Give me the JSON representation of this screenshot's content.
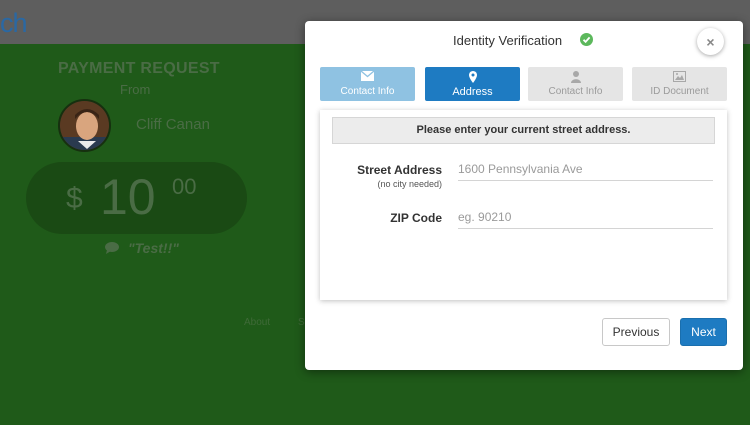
{
  "app": {
    "logo_text": "ch"
  },
  "payment": {
    "title": "PAYMENT REQUEST",
    "from_label": "From",
    "payer_name": "Cliff Canan",
    "currency_symbol": "$",
    "amount_whole": "10",
    "amount_cents": "00",
    "note": "\"Test!!\""
  },
  "footer": {
    "links": [
      "About",
      "S"
    ]
  },
  "modal": {
    "title": "Identity Verification",
    "title_icon": "check-circle-icon",
    "close_label": "×",
    "steps": [
      {
        "label": "Contact Info",
        "icon": "envelope-icon",
        "state": "completed"
      },
      {
        "label": "Address",
        "icon": "map-pin-icon",
        "state": "active"
      },
      {
        "label": "Contact Info",
        "icon": "user-icon",
        "state": "pending"
      },
      {
        "label": "ID Document",
        "icon": "image-icon",
        "state": "pending"
      }
    ],
    "instruction": "Please enter your current street address.",
    "fields": {
      "street": {
        "label": "Street Address",
        "sublabel": "(no city needed)",
        "value": "",
        "placeholder": "1600 Pennsylvania Ave"
      },
      "zip": {
        "label": "ZIP Code",
        "value": "",
        "placeholder": "eg. 90210"
      }
    },
    "buttons": {
      "previous": "Previous",
      "next": "Next"
    }
  },
  "colors": {
    "page_background": "#1f5a19",
    "primary": "#1e7bc2",
    "step_completed": "#8fc2e2",
    "step_pending": "#e5e5e5",
    "success": "#5cb85c"
  }
}
